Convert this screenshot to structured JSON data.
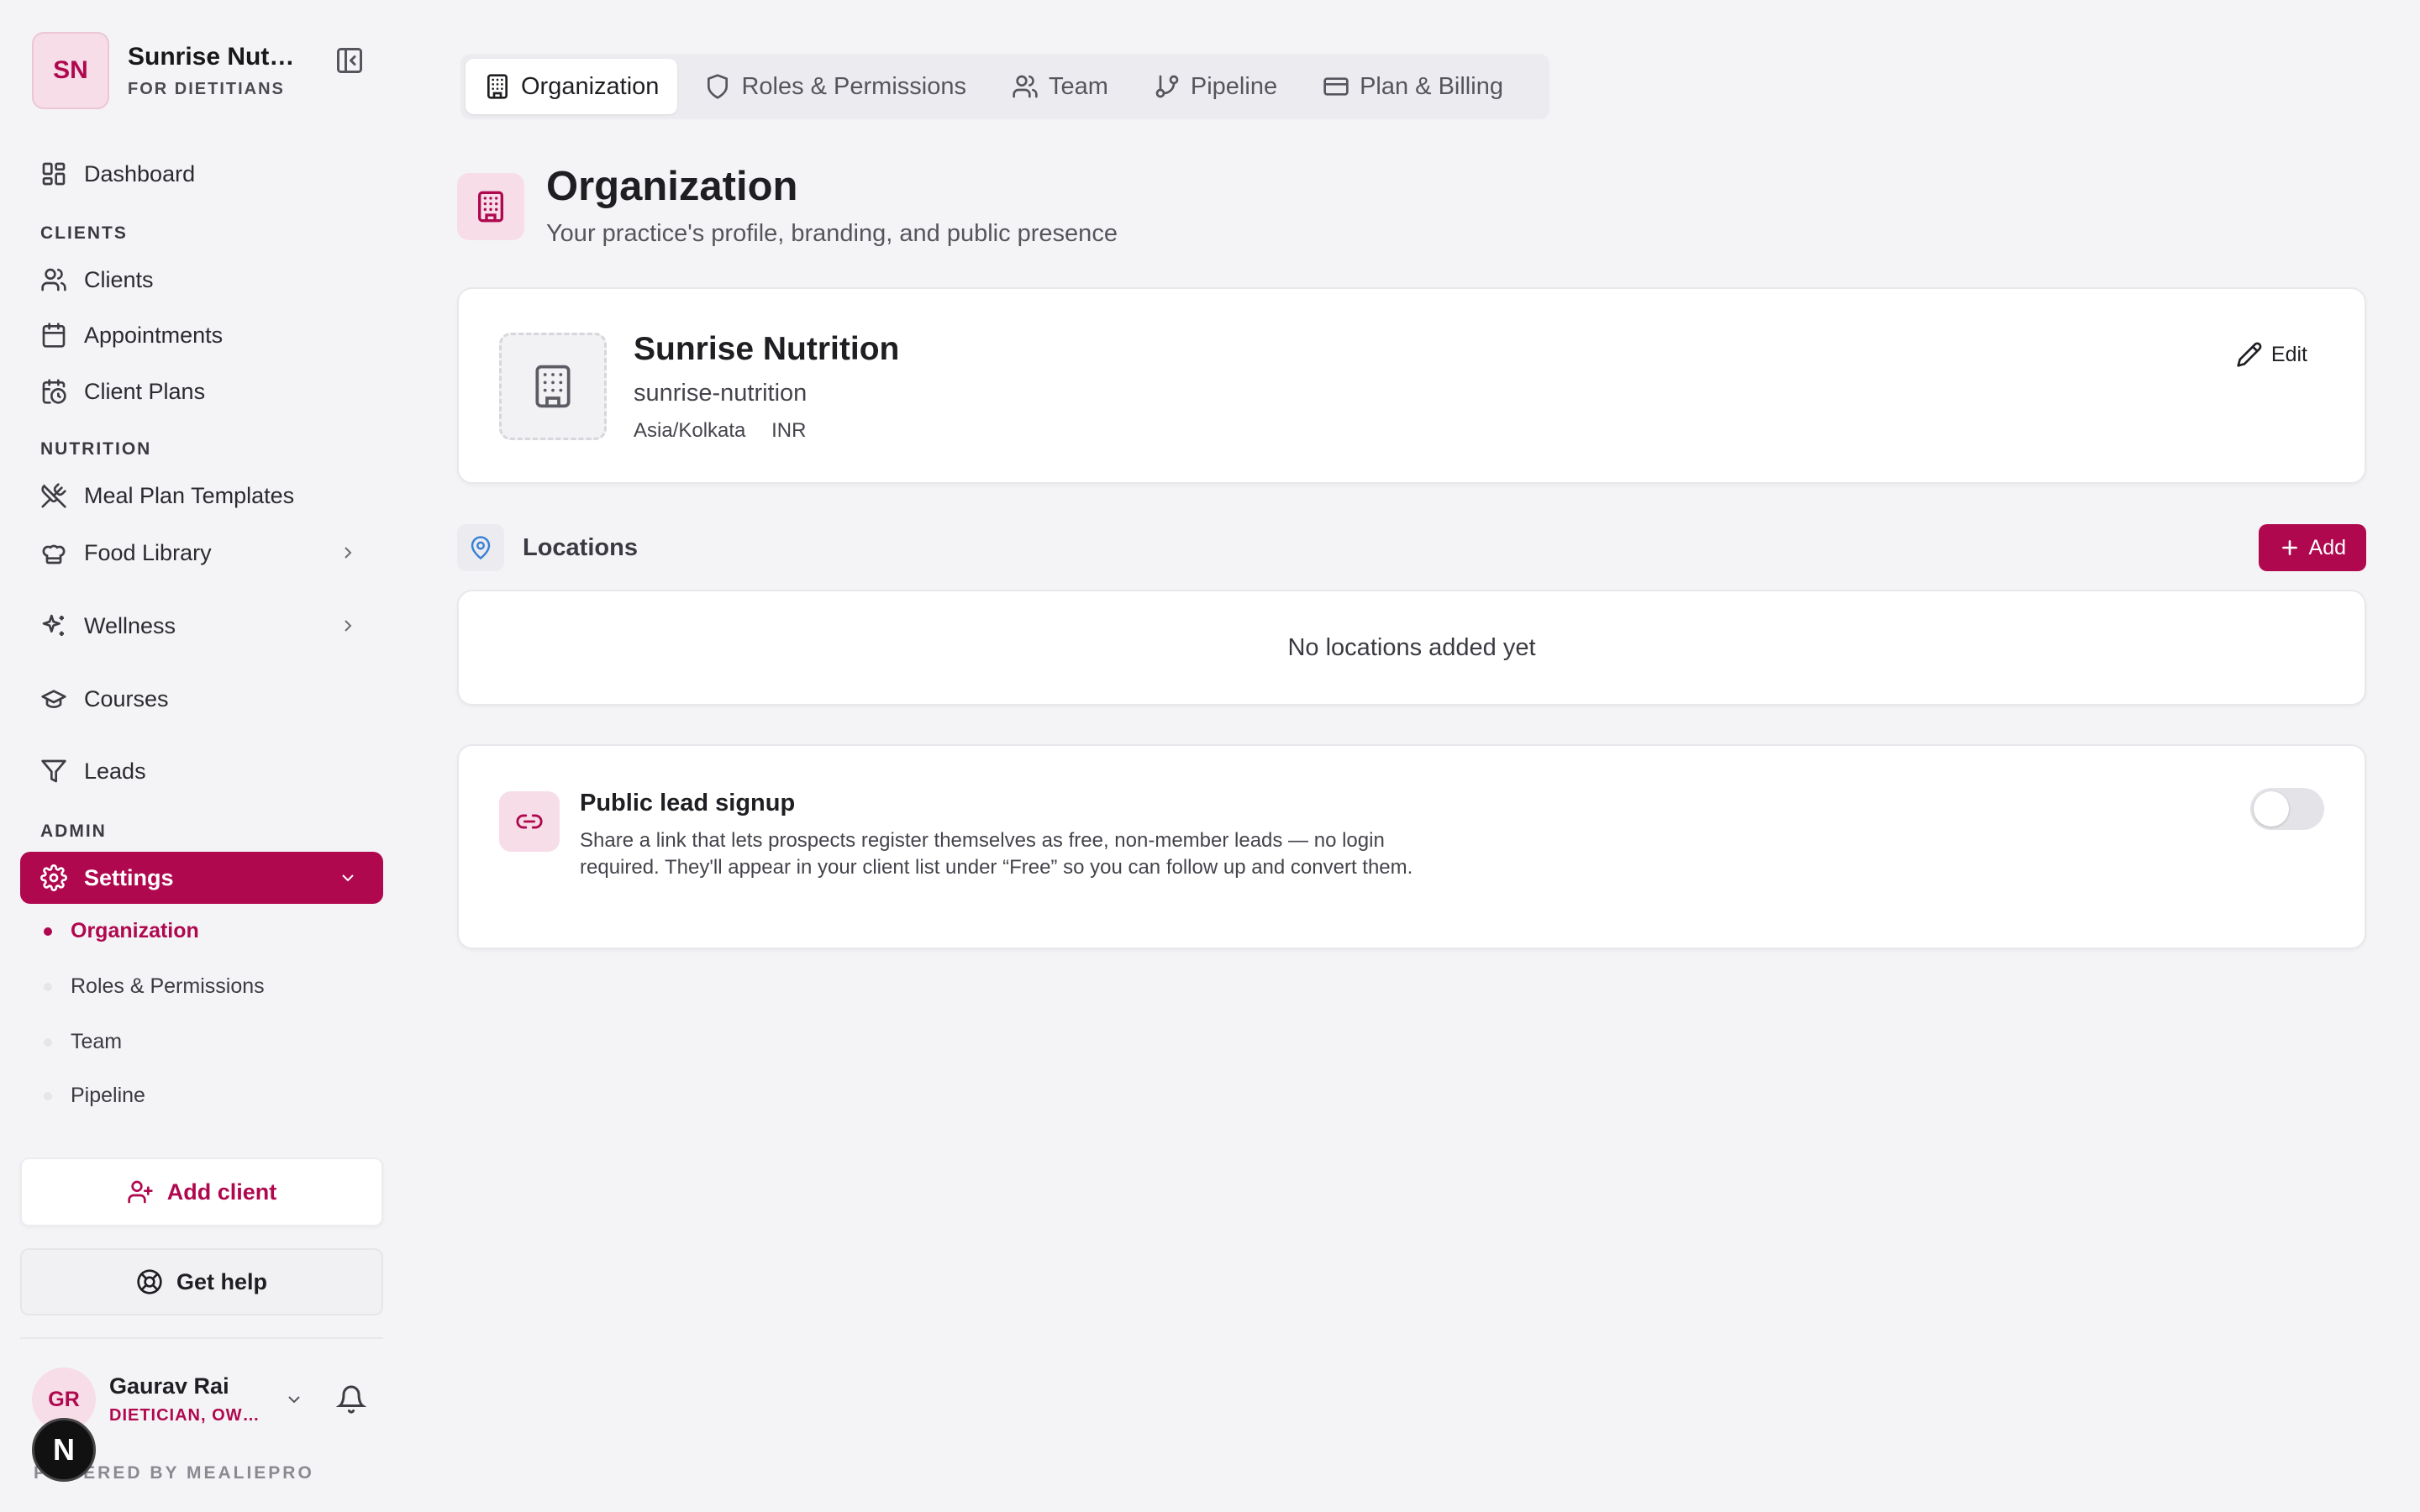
{
  "org": {
    "initials": "SN",
    "name": "Sunrise Nutr…",
    "subtitle": "FOR DIETITIANS"
  },
  "sidebar": {
    "dashboard": "Dashboard",
    "section_clients": "CLIENTS",
    "clients": "Clients",
    "appointments": "Appointments",
    "client_plans": "Client Plans",
    "section_nutrition": "NUTRITION",
    "meal_plan_templates": "Meal Plan Templates",
    "food_library": "Food Library",
    "wellness": "Wellness",
    "courses": "Courses",
    "leads": "Leads",
    "section_admin": "ADMIN",
    "settings": "Settings",
    "sub": [
      "Organization",
      "Roles & Permissions",
      "Team",
      "Pipeline"
    ],
    "add_client": "Add client",
    "get_help": "Get help"
  },
  "user": {
    "initials": "GR",
    "name": "Gaurav Rai",
    "role": "DIETICIAN, OW…"
  },
  "footer": {
    "powered": "POWERED BY MEALIEPRO",
    "badge": "N"
  },
  "tabs": [
    "Organization",
    "Roles & Permissions",
    "Team",
    "Pipeline",
    "Plan & Billing"
  ],
  "page": {
    "title": "Organization",
    "subtitle": "Your practice's profile, branding, and public presence"
  },
  "org_card": {
    "name": "Sunrise Nutrition",
    "slug": "sunrise-nutrition",
    "timezone": "Asia/Kolkata",
    "currency": "INR",
    "edit": "Edit"
  },
  "locations": {
    "title": "Locations",
    "add": "Add",
    "empty": "No locations added yet"
  },
  "lead_signup": {
    "title": "Public lead signup",
    "description": "Share a link that lets prospects register themselves as free, non-member leads — no login required. They'll appear in your client list under “Free” so you can follow up and convert them.",
    "enabled": false
  },
  "colors": {
    "accent": "#b0084f",
    "accent_light": "#f6dde8",
    "background": "#f4f4f6"
  }
}
